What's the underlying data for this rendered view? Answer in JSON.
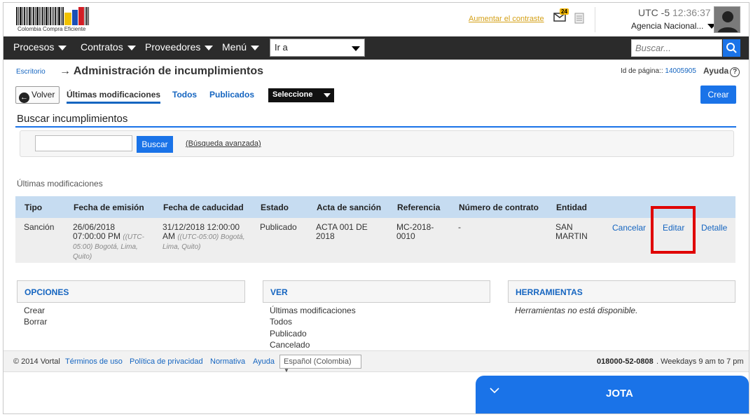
{
  "header": {
    "logo_text": "Colombia Compra Eficiente",
    "contrast_link": "Aumentar el contraste",
    "mail_count": "24",
    "utc_label": "UTC -5",
    "time": "12:36:37",
    "agency": "Agencia Nacional..."
  },
  "nav": {
    "items": [
      "Procesos",
      "Contratos",
      "Proveedores",
      "Menú"
    ],
    "goto_value": "Ir a",
    "search_placeholder": "Buscar..."
  },
  "page": {
    "breadcrumb": "Escritorio",
    "arrow": "→",
    "title": "Administración de incumplimientos",
    "id_label": "Id de página::",
    "id_value": "14005905",
    "help": "Ayuda",
    "help_icon": "?"
  },
  "tabs": {
    "back": "Volver",
    "items": [
      "Últimas modificaciones",
      "Todos",
      "Publicados"
    ],
    "select": "Seleccione",
    "create": "Crear"
  },
  "search": {
    "section_title": "Buscar incumplimientos",
    "button": "Buscar",
    "advanced": "(Búsqueda avanzada)"
  },
  "results": {
    "label": "Últimas modificaciones",
    "columns": [
      "Tipo",
      "Fecha de emisión",
      "Fecha de caducidad",
      "Estado",
      "Acta de sanción",
      "Referencia",
      "Número de contrato",
      "Entidad"
    ],
    "rows": [
      {
        "tipo": "Sanción",
        "emision_1": "26/06/2018",
        "emision_2": "07:00:00 PM",
        "emision_tz": "((UTC-05:00) Bogotá, Lima, Quito)",
        "caducidad_1": "31/12/2018 12:00:00",
        "caducidad_2": "AM",
        "caducidad_tz": "((UTC-05:00) Bogotá, Lima, Quito)",
        "estado": "Publicado",
        "acta_1": "ACTA 001 DE",
        "acta_2": "2018",
        "ref_1": "MC-2018-",
        "ref_2": "0010",
        "contrato": "-",
        "entidad_1": "SAN",
        "entidad_2": "MARTIN",
        "actions": [
          "Cancelar",
          "Editar",
          "Detalle"
        ]
      }
    ]
  },
  "panels": {
    "opciones": {
      "title": "OPCIONES",
      "items": [
        "Crear",
        "Borrar"
      ]
    },
    "ver": {
      "title": "VER",
      "items": [
        "Últimas modificaciones",
        "Todos",
        "Publicado",
        "Cancelado"
      ]
    },
    "herramientas": {
      "title": "HERRAMIENTAS",
      "note": "Herramientas no está disponible."
    }
  },
  "footer": {
    "copyright": "© 2014 Vortal",
    "links": [
      "Términos de uso",
      "Política de privacidad",
      "Normativa",
      "Ayuda"
    ],
    "language": "Español (Colombia)",
    "phone": "018000-52-0808",
    "hours": ". Weekdays 9 am to 7 pm"
  },
  "chat": {
    "title": "JOTA"
  },
  "colors": {
    "accent": "#1a73e8",
    "nav_bg": "#2b2b2b",
    "table_head": "#c6dcf1",
    "highlight": "#e00000"
  }
}
